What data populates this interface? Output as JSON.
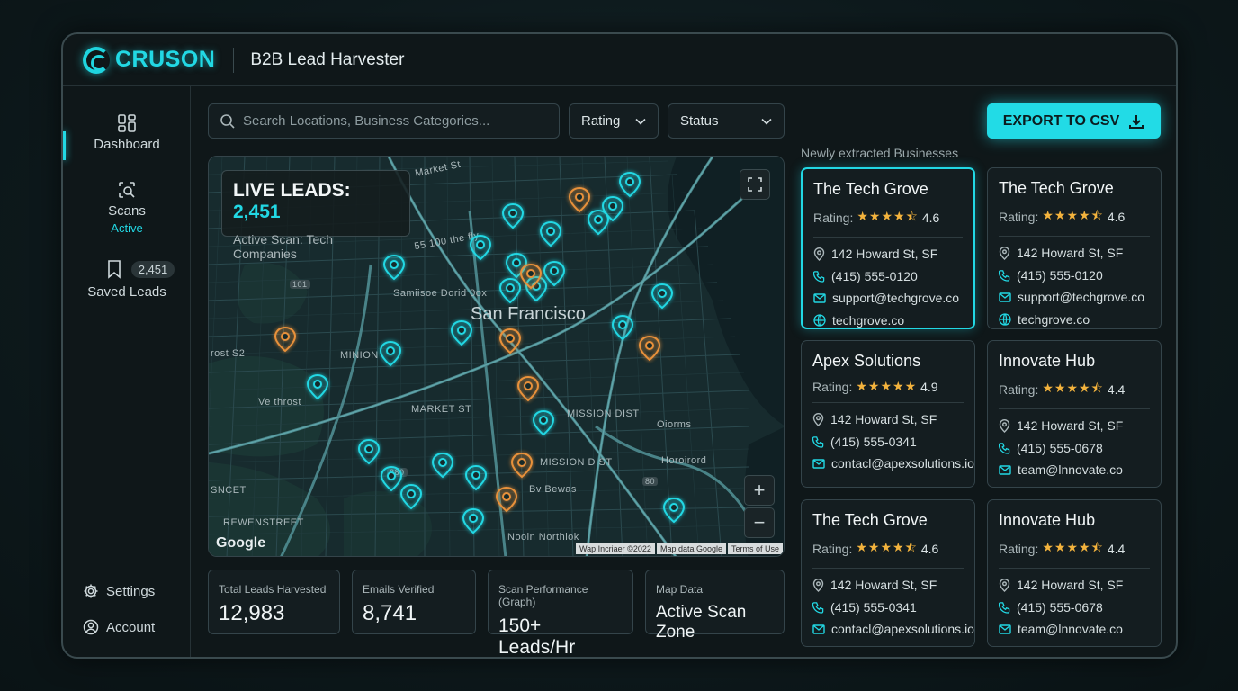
{
  "brand": {
    "name": "CRUSON",
    "app_title": "B2B Lead Harvester"
  },
  "sidebar": {
    "items": [
      {
        "label": "Dashboard",
        "icon": "dashboard-grid-icon"
      },
      {
        "label": "Scans",
        "sub": "Active",
        "icon": "scan-search-icon"
      },
      {
        "label": "Saved Leads",
        "badge": "2,451",
        "icon": "bookmark-icon"
      }
    ],
    "bottom": [
      {
        "label": "Settings",
        "icon": "gear-icon"
      },
      {
        "label": "Account",
        "icon": "user-icon"
      }
    ]
  },
  "toolbar": {
    "search_placeholder": "Search Locations, Business Categories...",
    "rating_label": "Rating",
    "status_label": "Status",
    "export_label": "EXPORT TO CSV"
  },
  "map": {
    "live_leads_label": "LIVE LEADS:",
    "live_leads_value": "2,451",
    "active_scan": "Active Scan: Tech Companies",
    "city": "San Francisco",
    "labels": {
      "market_st": "Market St",
      "st_100": "55 100 the fly",
      "samiise": "Samiisoe Dorid 0ox",
      "minion": "MINION",
      "rost": "rost S2",
      "ve_throst": "Ve throst",
      "market_st2": "MARKET ST",
      "mission1": "MISSION DIST",
      "oiorms": "Oiorms",
      "mission2": "MISSION DIST",
      "horoirord": "Horoirord",
      "bv_bewas": "Bv Bewas",
      "sncet": "SNCET",
      "rewenstreet": "REWENSTREET",
      "nooin": "Nooin Northiok",
      "badge_101": "101",
      "badge_280": "280",
      "badge_80": "80"
    },
    "google": "Google",
    "attribution": [
      "Wap Incriaer ©2022",
      "Map data Google",
      "Terms of Use"
    ],
    "zoom_in": "+",
    "zoom_out": "−"
  },
  "stats": [
    {
      "label": "Total Leads Harvested",
      "value": "12,983"
    },
    {
      "label": "Emails Verified",
      "value": "8,741"
    },
    {
      "label": "Scan Performance (Graph)",
      "value": "150+ Leads/Hr"
    },
    {
      "label": "Map Data",
      "value": "Active Scan Zone"
    }
  ],
  "panel": {
    "title": "Newly extracted Businesses",
    "rating_prefix": "Rating:",
    "cards": [
      {
        "name": "The Tech Grove",
        "rating": "4.6",
        "stars": "★★★★⯪",
        "address": "142 Howard St, SF",
        "phone": "(415) 555-0120",
        "email": "support@techgrove.co",
        "website": "techgrove.co"
      },
      {
        "name": "The Tech Grove",
        "rating": "4.6",
        "stars": "★★★★⯪",
        "address": "142 Howard St, SF",
        "phone": "(415) 555-0120",
        "email": "support@techgrove.co",
        "website": "techgrove.co"
      },
      {
        "name": "Apex Solutions",
        "rating": "4.9",
        "stars": "★★★★★",
        "address": "142 Howard St, SF",
        "phone": "(415) 555-0341",
        "email": "contacl@apexsolutions.io"
      },
      {
        "name": "Innovate Hub",
        "rating": "4.4",
        "stars": "★★★★⯪",
        "address": "142 Howard St, SF",
        "phone": "(415) 555-0678",
        "email": "team@lnnovate.co"
      },
      {
        "name": "The Tech Grove",
        "rating": "4.6",
        "stars": "★★★★⯪",
        "address": "142 Howard St, SF",
        "phone": "(415) 555-0341",
        "email": "contacl@apexsolutions.io"
      },
      {
        "name": "Innovate Hub",
        "rating": "4.4",
        "stars": "★★★★⯪",
        "address": "142 Howard St, SF",
        "phone": "(415) 555-0678",
        "email": "team@lnnovate.co"
      }
    ]
  },
  "colors": {
    "accent": "#22d8e4",
    "pin_orange": "#e8913a",
    "star": "#f3b33d",
    "bg": "#0f1719"
  }
}
